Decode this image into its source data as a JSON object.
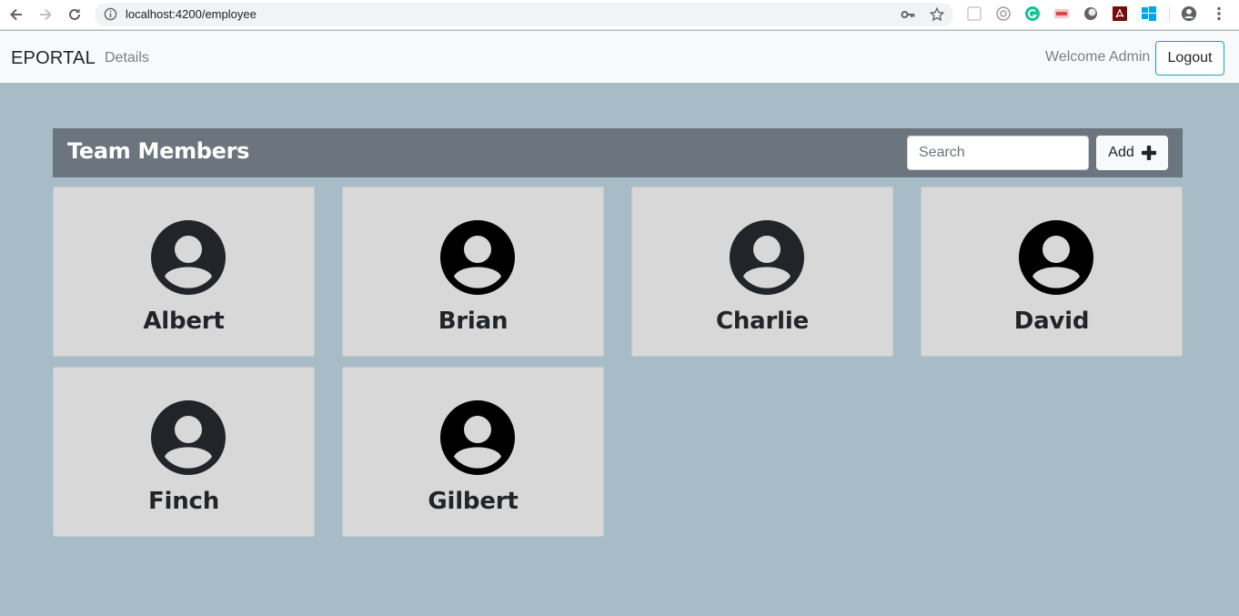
{
  "browser": {
    "url": "localhost:4200/employee"
  },
  "navbar": {
    "brand": "EPORTAL",
    "link": "Details",
    "welcome": "Welcome Admin",
    "logout_label": "Logout"
  },
  "team": {
    "title": "Team Members",
    "search_placeholder": "Search",
    "add_label": "Add"
  },
  "members": [
    {
      "name": "Albert",
      "avatar_color": "#212529"
    },
    {
      "name": "Brian",
      "avatar_color": "#000000"
    },
    {
      "name": "Charlie",
      "avatar_color": "#212529"
    },
    {
      "name": "David",
      "avatar_color": "#000000"
    },
    {
      "name": "Finch",
      "avatar_color": "#212529"
    },
    {
      "name": "Gilbert",
      "avatar_color": "#000000"
    }
  ],
  "colors": {
    "page_bg": "#a8bcc7",
    "header_bg": "#6c757d",
    "card_bg": "#d8d8d8",
    "logout_border": "#17a2b8"
  }
}
